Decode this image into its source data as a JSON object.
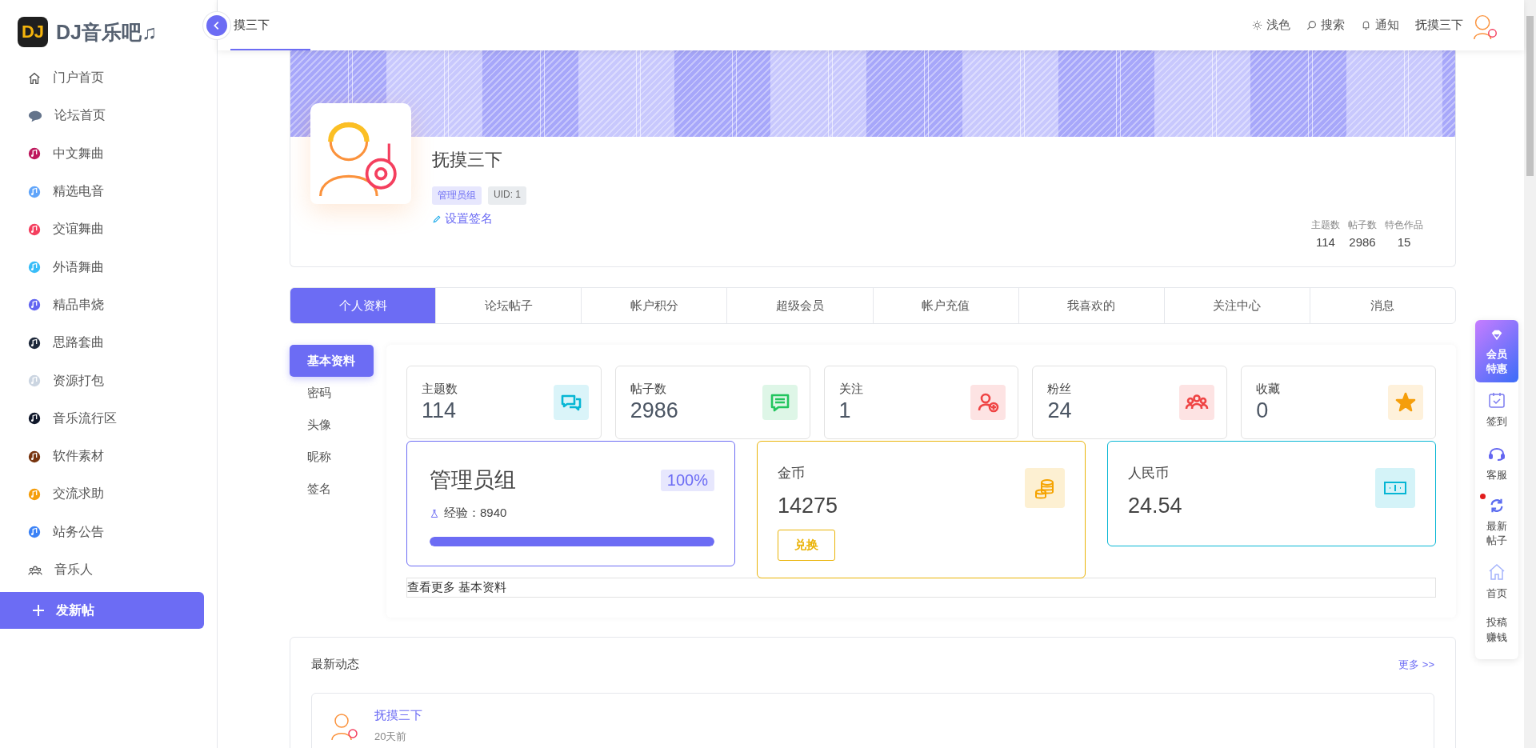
{
  "logo": {
    "badge": "DJ",
    "text": "DJ音乐吧♫"
  },
  "sidebar": {
    "items": [
      {
        "label": "门户首页",
        "selected": false
      },
      {
        "label": "论坛首页",
        "selected": false
      },
      {
        "label": "中文舞曲",
        "selected": false
      },
      {
        "label": "精选电音",
        "selected": false
      },
      {
        "label": "交谊舞曲",
        "selected": false
      },
      {
        "label": "外语舞曲",
        "selected": false
      },
      {
        "label": "精品串烧",
        "selected": false
      },
      {
        "label": "思路套曲",
        "selected": false
      },
      {
        "label": "资源打包",
        "selected": false
      },
      {
        "label": "音乐流行区",
        "selected": false
      },
      {
        "label": "软件素材",
        "selected": false
      },
      {
        "label": "交流求助",
        "selected": false
      },
      {
        "label": "站务公告",
        "selected": false
      },
      {
        "label": "音乐人",
        "selected": false
      }
    ],
    "new_post": "发新帖"
  },
  "header": {
    "tab": "摸三下",
    "actions": [
      "浅色",
      "搜索",
      "通知"
    ],
    "user": "抚摸三下"
  },
  "profile": {
    "name": "抚摸三下",
    "badges": [
      "管理员组",
      "UID: 1"
    ],
    "signature_link": "设置签名",
    "stats": [
      {
        "label": "主题数",
        "value": "114"
      },
      {
        "label": "帖子数",
        "value": "2986"
      },
      {
        "label": "特色作品",
        "value": "15"
      }
    ]
  },
  "tabs": [
    {
      "label": "个人资料",
      "selected": true
    },
    {
      "label": "论坛帖子",
      "selected": false
    },
    {
      "label": "帐户积分",
      "selected": false
    },
    {
      "label": "超级会员",
      "selected": false
    },
    {
      "label": "帐户充值",
      "selected": false
    },
    {
      "label": "我喜欢的",
      "selected": false
    },
    {
      "label": "关注中心",
      "selected": false
    },
    {
      "label": "消息",
      "selected": false
    }
  ],
  "subnav": [
    {
      "label": "基本资料",
      "selected": true
    },
    {
      "label": "密码",
      "selected": false
    },
    {
      "label": "头像",
      "selected": false
    },
    {
      "label": "昵称",
      "selected": false
    },
    {
      "label": "签名",
      "selected": false
    }
  ],
  "stat_cards": [
    {
      "label": "主题数",
      "value": "114",
      "color": "#06b6d4"
    },
    {
      "label": "帖子数",
      "value": "2986",
      "color": "#22c55e"
    },
    {
      "label": "关注",
      "value": "1",
      "color": "#ef4444"
    },
    {
      "label": "粉丝",
      "value": "24",
      "color": "#ef4444"
    },
    {
      "label": "收藏",
      "value": "0",
      "color": "#f59e0b"
    }
  ],
  "group_card": {
    "title": "管理员组",
    "percent": "100%",
    "exp": "经验：8940",
    "level": 1
  },
  "gold_card": {
    "label": "金币",
    "value": "14275",
    "button": "兑换"
  },
  "rmb_card": {
    "label": "人民币",
    "value": "24.54"
  },
  "more_link": "查看更多 基本资料",
  "activity": {
    "title": "最新动态",
    "more": "更多 >>",
    "items": [
      {
        "user": "抚摸三下",
        "time": "20天前"
      }
    ]
  },
  "float_bar": [
    {
      "label": "会员特惠",
      "kind": "vip",
      "dot": false
    },
    {
      "label": "签到",
      "kind": "calendar",
      "dot": false
    },
    {
      "label": "客服",
      "kind": "headset",
      "dot": false
    },
    {
      "label": "最新帖子",
      "kind": "refresh",
      "dot": true
    },
    {
      "label": "首页",
      "kind": "home",
      "dot": false
    },
    {
      "label": "投稿赚钱",
      "kind": "text",
      "dot": false
    }
  ]
}
